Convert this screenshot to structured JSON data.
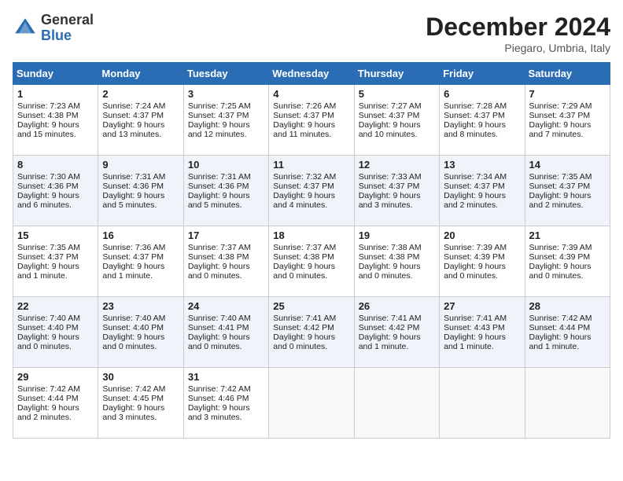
{
  "header": {
    "logo_general": "General",
    "logo_blue": "Blue",
    "month": "December 2024",
    "location": "Piegaro, Umbria, Italy"
  },
  "days_of_week": [
    "Sunday",
    "Monday",
    "Tuesday",
    "Wednesday",
    "Thursday",
    "Friday",
    "Saturday"
  ],
  "weeks": [
    [
      {
        "day": "1",
        "sunrise": "7:23 AM",
        "sunset": "4:38 PM",
        "daylight": "9 hours and 15 minutes."
      },
      {
        "day": "2",
        "sunrise": "7:24 AM",
        "sunset": "4:37 PM",
        "daylight": "9 hours and 13 minutes."
      },
      {
        "day": "3",
        "sunrise": "7:25 AM",
        "sunset": "4:37 PM",
        "daylight": "9 hours and 12 minutes."
      },
      {
        "day": "4",
        "sunrise": "7:26 AM",
        "sunset": "4:37 PM",
        "daylight": "9 hours and 11 minutes."
      },
      {
        "day": "5",
        "sunrise": "7:27 AM",
        "sunset": "4:37 PM",
        "daylight": "9 hours and 10 minutes."
      },
      {
        "day": "6",
        "sunrise": "7:28 AM",
        "sunset": "4:37 PM",
        "daylight": "9 hours and 8 minutes."
      },
      {
        "day": "7",
        "sunrise": "7:29 AM",
        "sunset": "4:37 PM",
        "daylight": "9 hours and 7 minutes."
      }
    ],
    [
      {
        "day": "8",
        "sunrise": "7:30 AM",
        "sunset": "4:36 PM",
        "daylight": "9 hours and 6 minutes."
      },
      {
        "day": "9",
        "sunrise": "7:31 AM",
        "sunset": "4:36 PM",
        "daylight": "9 hours and 5 minutes."
      },
      {
        "day": "10",
        "sunrise": "7:31 AM",
        "sunset": "4:36 PM",
        "daylight": "9 hours and 5 minutes."
      },
      {
        "day": "11",
        "sunrise": "7:32 AM",
        "sunset": "4:37 PM",
        "daylight": "9 hours and 4 minutes."
      },
      {
        "day": "12",
        "sunrise": "7:33 AM",
        "sunset": "4:37 PM",
        "daylight": "9 hours and 3 minutes."
      },
      {
        "day": "13",
        "sunrise": "7:34 AM",
        "sunset": "4:37 PM",
        "daylight": "9 hours and 2 minutes."
      },
      {
        "day": "14",
        "sunrise": "7:35 AM",
        "sunset": "4:37 PM",
        "daylight": "9 hours and 2 minutes."
      }
    ],
    [
      {
        "day": "15",
        "sunrise": "7:35 AM",
        "sunset": "4:37 PM",
        "daylight": "9 hours and 1 minute."
      },
      {
        "day": "16",
        "sunrise": "7:36 AM",
        "sunset": "4:37 PM",
        "daylight": "9 hours and 1 minute."
      },
      {
        "day": "17",
        "sunrise": "7:37 AM",
        "sunset": "4:38 PM",
        "daylight": "9 hours and 0 minutes."
      },
      {
        "day": "18",
        "sunrise": "7:37 AM",
        "sunset": "4:38 PM",
        "daylight": "9 hours and 0 minutes."
      },
      {
        "day": "19",
        "sunrise": "7:38 AM",
        "sunset": "4:38 PM",
        "daylight": "9 hours and 0 minutes."
      },
      {
        "day": "20",
        "sunrise": "7:39 AM",
        "sunset": "4:39 PM",
        "daylight": "9 hours and 0 minutes."
      },
      {
        "day": "21",
        "sunrise": "7:39 AM",
        "sunset": "4:39 PM",
        "daylight": "9 hours and 0 minutes."
      }
    ],
    [
      {
        "day": "22",
        "sunrise": "7:40 AM",
        "sunset": "4:40 PM",
        "daylight": "9 hours and 0 minutes."
      },
      {
        "day": "23",
        "sunrise": "7:40 AM",
        "sunset": "4:40 PM",
        "daylight": "9 hours and 0 minutes."
      },
      {
        "day": "24",
        "sunrise": "7:40 AM",
        "sunset": "4:41 PM",
        "daylight": "9 hours and 0 minutes."
      },
      {
        "day": "25",
        "sunrise": "7:41 AM",
        "sunset": "4:42 PM",
        "daylight": "9 hours and 0 minutes."
      },
      {
        "day": "26",
        "sunrise": "7:41 AM",
        "sunset": "4:42 PM",
        "daylight": "9 hours and 1 minute."
      },
      {
        "day": "27",
        "sunrise": "7:41 AM",
        "sunset": "4:43 PM",
        "daylight": "9 hours and 1 minute."
      },
      {
        "day": "28",
        "sunrise": "7:42 AM",
        "sunset": "4:44 PM",
        "daylight": "9 hours and 1 minute."
      }
    ],
    [
      {
        "day": "29",
        "sunrise": "7:42 AM",
        "sunset": "4:44 PM",
        "daylight": "9 hours and 2 minutes."
      },
      {
        "day": "30",
        "sunrise": "7:42 AM",
        "sunset": "4:45 PM",
        "daylight": "9 hours and 3 minutes."
      },
      {
        "day": "31",
        "sunrise": "7:42 AM",
        "sunset": "4:46 PM",
        "daylight": "9 hours and 3 minutes."
      },
      null,
      null,
      null,
      null
    ]
  ]
}
